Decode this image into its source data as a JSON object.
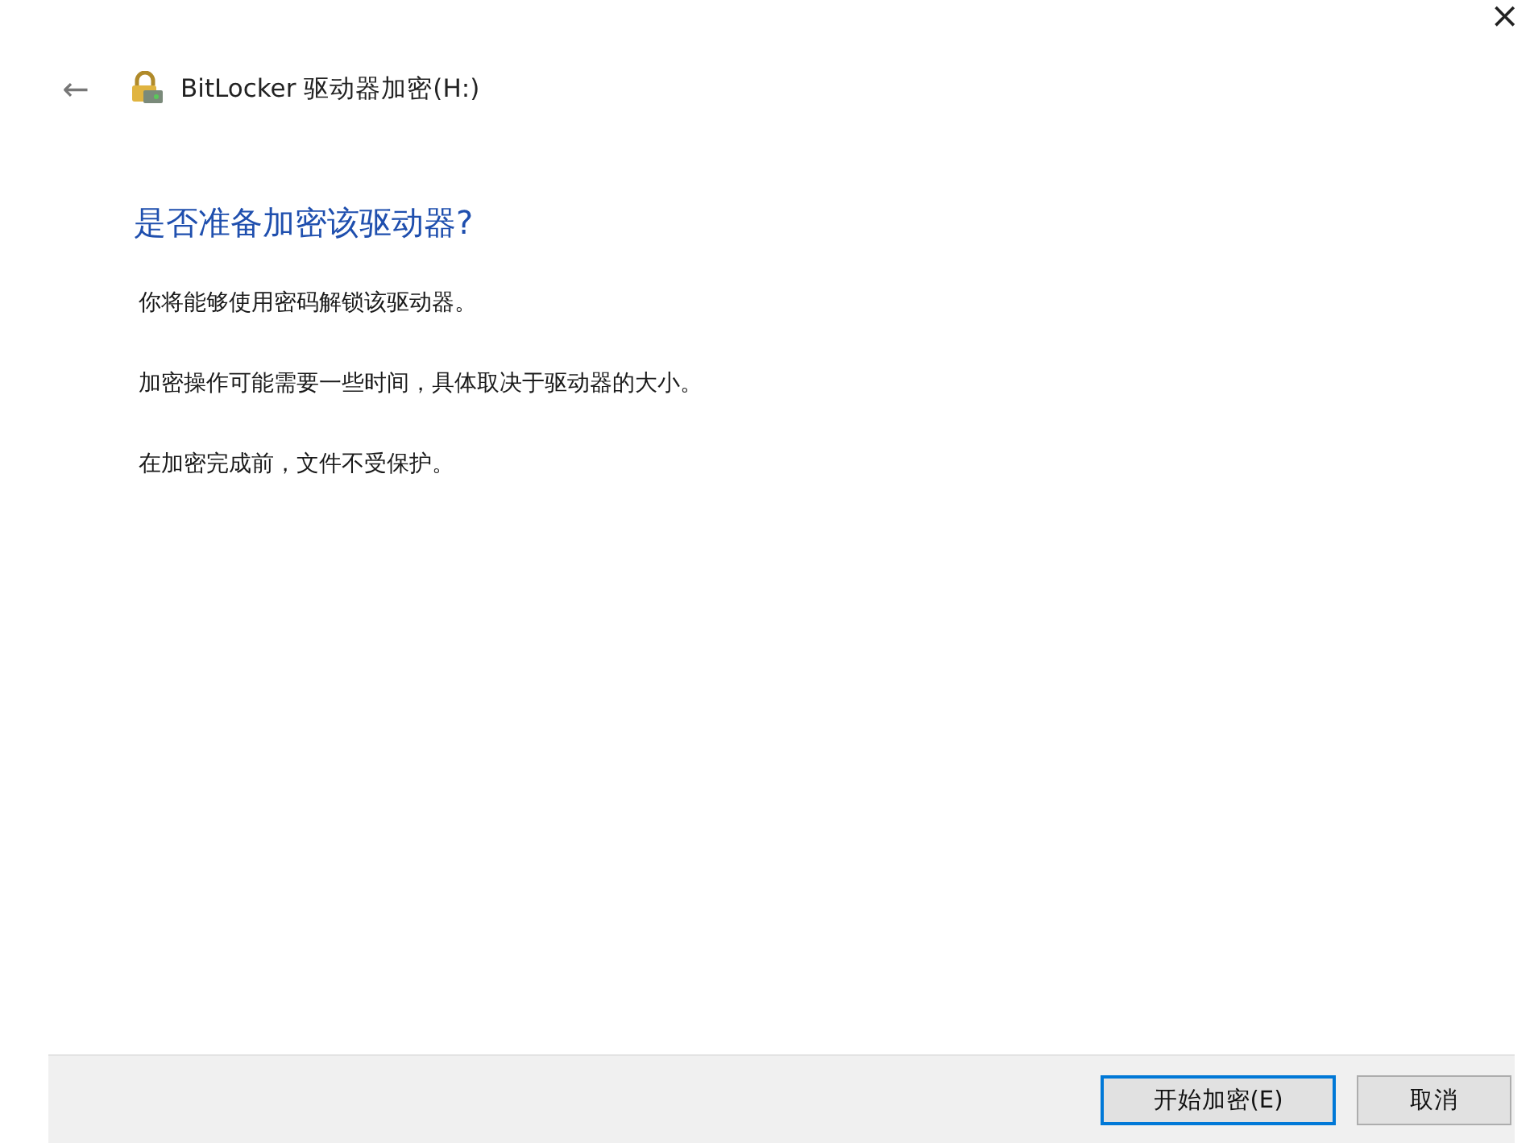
{
  "window": {
    "close": "×"
  },
  "header": {
    "back": "←",
    "title": "BitLocker 驱动器加密(H:)"
  },
  "heading": "是否准备加密该驱动器?",
  "paragraphs": [
    "你将能够使用密码解锁该驱动器。",
    "加密操作可能需要一些时间，具体取决于驱动器的大小。",
    "在加密完成前，文件不受保护。"
  ],
  "buttons": [
    {
      "label": "开始加密(E)",
      "default": true
    },
    {
      "label": "取消",
      "default": false
    }
  ]
}
